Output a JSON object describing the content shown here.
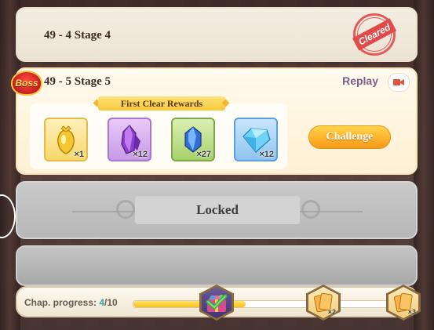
{
  "stages": {
    "cleared": {
      "title": "49 - 4  Stage 4",
      "stamp": "Cleared"
    },
    "boss": {
      "badge": "Boss",
      "title": "49 - 5  Stage 5",
      "replay_label": "Replay",
      "rewards_header": "First Clear Rewards",
      "rewards": [
        {
          "icon": "golden-bell-icon",
          "qty": "×1",
          "color": "#f7d76c"
        },
        {
          "icon": "purple-crystal-icon",
          "qty": "×12",
          "color": "#c79ae6"
        },
        {
          "icon": "blue-crystal-icon",
          "qty": "×27",
          "color": "#a7d16c"
        },
        {
          "icon": "diamond-gem-icon",
          "qty": "×12",
          "color": "#8ec4ef"
        }
      ],
      "challenge_label": "Challenge"
    },
    "locked": {
      "label": "Locked"
    }
  },
  "progress": {
    "label": "Chap. progress: ",
    "current": "4",
    "total": "/10",
    "fill_fraction": 0.42,
    "nodes": [
      {
        "icon": "gift-chest-icon",
        "qty": "",
        "claimed": true
      },
      {
        "icon": "card-pack-icon",
        "qty": "×2",
        "claimed": false
      },
      {
        "icon": "card-pack-icon",
        "qty": "×3",
        "claimed": false
      }
    ]
  },
  "colors": {
    "accent": "#f7c83a",
    "challenge": "#ffb22b",
    "stamp": "#e04a4a"
  }
}
